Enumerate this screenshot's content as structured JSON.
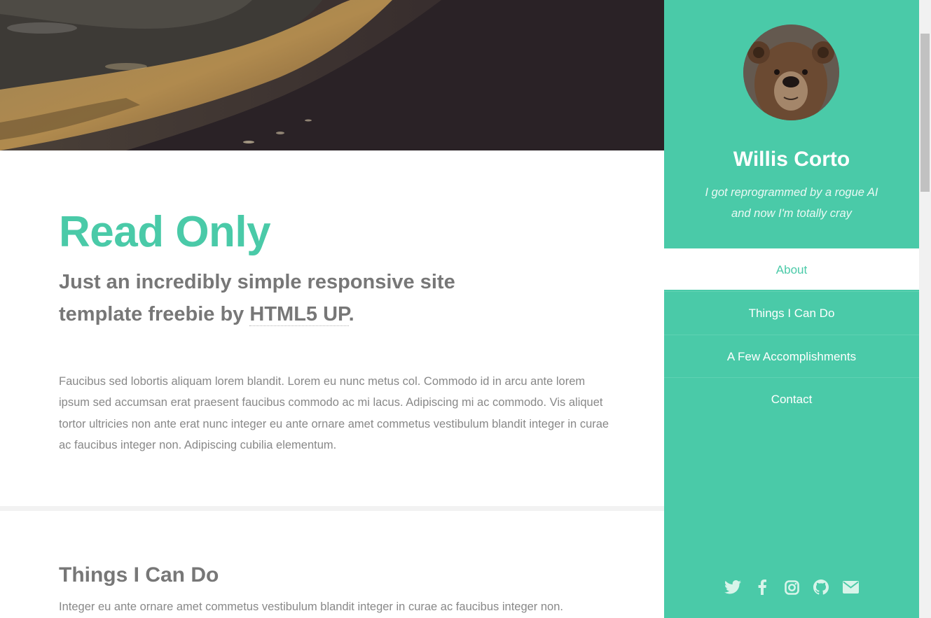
{
  "intro": {
    "title": "Read Only",
    "tagline_prefix": "Just an incredibly simple responsive site template freebie by ",
    "tagline_link": "HTML5 UP",
    "tagline_suffix": ".",
    "body": "Faucibus sed lobortis aliquam lorem blandit. Lorem eu nunc metus col. Commodo id in arcu ante lorem ipsum sed accumsan erat praesent faucibus commodo ac mi lacus. Adipiscing mi ac commodo. Vis aliquet tortor ultricies non ante erat nunc integer eu ante ornare amet commetus vestibulum blandit integer in curae ac faucibus integer non. Adipiscing cubilia elementum."
  },
  "section2": {
    "title": "Things I Can Do",
    "body": "Integer eu ante ornare amet commetus vestibulum blandit integer in curae ac faucibus integer non."
  },
  "sidebar": {
    "name": "Willis Corto",
    "bio_line1": "I got reprogrammed by a rogue AI",
    "bio_line2": "and now I'm totally cray",
    "nav": [
      {
        "label": "About",
        "active": true
      },
      {
        "label": "Things I Can Do",
        "active": false
      },
      {
        "label": "A Few Accomplishments",
        "active": false
      },
      {
        "label": "Contact",
        "active": false
      }
    ],
    "social_icons": [
      "twitter-icon",
      "facebook-icon",
      "instagram-icon",
      "github-icon",
      "envelope-icon"
    ]
  },
  "colors": {
    "accent": "#4acaa8",
    "text": "#777777",
    "body_text": "#888888",
    "white": "#ffffff"
  }
}
